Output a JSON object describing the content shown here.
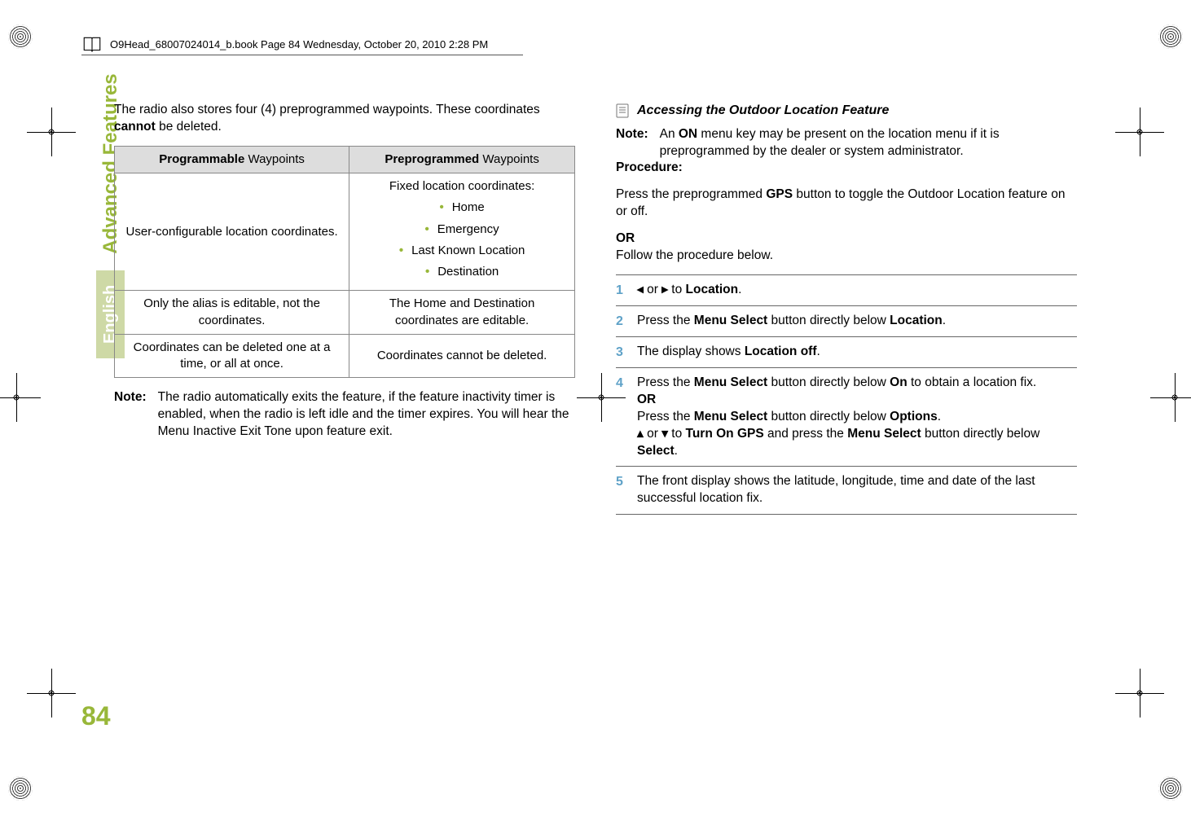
{
  "header": {
    "running_head": "O9Head_68007024014_b.book  Page 84  Wednesday, October 20, 2010  2:28 PM"
  },
  "sidebar": {
    "section": "Advanced Features",
    "language": "English",
    "page_number": "84"
  },
  "left": {
    "intro": "The radio also stores four (4) preprogrammed waypoints. These coordinates ",
    "intro_bold": "cannot",
    "intro_tail": " be deleted.",
    "table": {
      "head_prog_b": "Programmable",
      "head_prog_tail": " Waypoints",
      "head_pre_b": "Preprogrammed",
      "head_pre_tail": " Waypoints",
      "r1c1": "User-configurable location coordinates.",
      "r1c2_lead": "Fixed location coordinates:",
      "r1c2_items": {
        "a": "Home",
        "b": "Emergency",
        "c": "Last Known Location",
        "d": "Destination"
      },
      "r2c1": "Only the alias is editable, not the coordinates.",
      "r2c2": "The Home and Destination coordinates are editable.",
      "r3c1": "Coordinates can be deleted one at a time, or all at once.",
      "r3c2": "Coordinates cannot be deleted."
    },
    "note_label": "Note:",
    "note_body": "The radio automatically exits the feature, if the feature inactivity timer is enabled, when the radio is left idle and the timer expires. You will hear the Menu Inactive Exit Tone upon feature exit."
  },
  "right": {
    "sub_title": "Accessing the Outdoor Location Feature",
    "note_label": "Note:",
    "note_body_1": "An ",
    "note_body_b": "ON",
    "note_body_2": " menu key may be present on the location menu if it is preprogrammed by the dealer or system administrator.",
    "procedure_label": "Procedure:",
    "proc_p1_a": "Press the preprogrammed ",
    "proc_p1_b": "GPS",
    "proc_p1_c": " button to toggle the Outdoor Location feature on or off.",
    "or": "OR",
    "proc_p2": "Follow the procedure below.",
    "steps": {
      "s1_a": " or ",
      "s1_b": " to ",
      "s1_loc": "Location",
      "s1_dot": ".",
      "s2_a": "Press the ",
      "s2_ms": "Menu Select",
      "s2_b": " button directly below ",
      "s2_loc": "Location",
      "s2_dot": ".",
      "s3_a": "The display shows ",
      "s3_scr": "Location off",
      "s3_dot": ".",
      "s4_a": "Press the ",
      "s4_ms": "Menu Select",
      "s4_b": " button directly below ",
      "s4_on": "On",
      "s4_c": " to obtain a location fix.",
      "s4_or": "OR",
      "s4_d": "Press the ",
      "s4_ms2": "Menu Select",
      "s4_e": " button directly below ",
      "s4_opt": "Options",
      "s4_dot": ".",
      "s4_f": " or ",
      "s4_g": " to ",
      "s4_gps": "Turn On GPS",
      "s4_h": " and press the ",
      "s4_ms3": "Menu Select",
      "s4_i": " button directly below ",
      "s4_sel": "Select",
      "s4_dot2": ".",
      "s5": "The front display shows the latitude, longitude, time and date of the last successful location fix."
    },
    "glyphs": {
      "left": "◂",
      "right": "▸",
      "up": "▴",
      "down": "▾"
    }
  }
}
